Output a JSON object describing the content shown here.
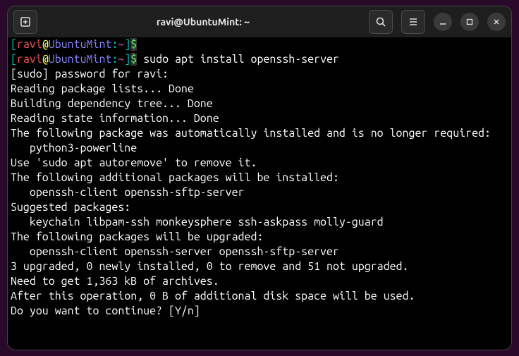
{
  "titlebar": {
    "title": "ravi@UbuntuMint: ~"
  },
  "prompt": {
    "open": "[",
    "user": "ravi",
    "at": "@",
    "host": "UbuntuMint",
    "colon": ":",
    "path": "~",
    "close": "]",
    "dollar": "$"
  },
  "commands": {
    "line1": "",
    "line2": " sudo apt install openssh-server"
  },
  "output": {
    "l1": "[sudo] password for ravi: ",
    "l2": "Reading package lists... Done",
    "l3": "Building dependency tree... Done",
    "l4": "Reading state information... Done",
    "l5": "The following package was automatically installed and is no longer required:",
    "l6": "   python3-powerline",
    "l7": "Use 'sudo apt autoremove' to remove it.",
    "l8": "The following additional packages will be installed:",
    "l9": "   openssh-client openssh-sftp-server",
    "l10": "Suggested packages:",
    "l11": "   keychain libpam-ssh monkeysphere ssh-askpass molly-guard",
    "l12": "The following packages will be upgraded:",
    "l13": "   openssh-client openssh-server openssh-sftp-server",
    "l14": "3 upgraded, 0 newly installed, 0 to remove and 51 not upgraded.",
    "l15": "Need to get 1,363 kB of archives.",
    "l16": "After this operation, 0 B of additional disk space will be used.",
    "l17": "Do you want to continue? [Y/n] "
  }
}
